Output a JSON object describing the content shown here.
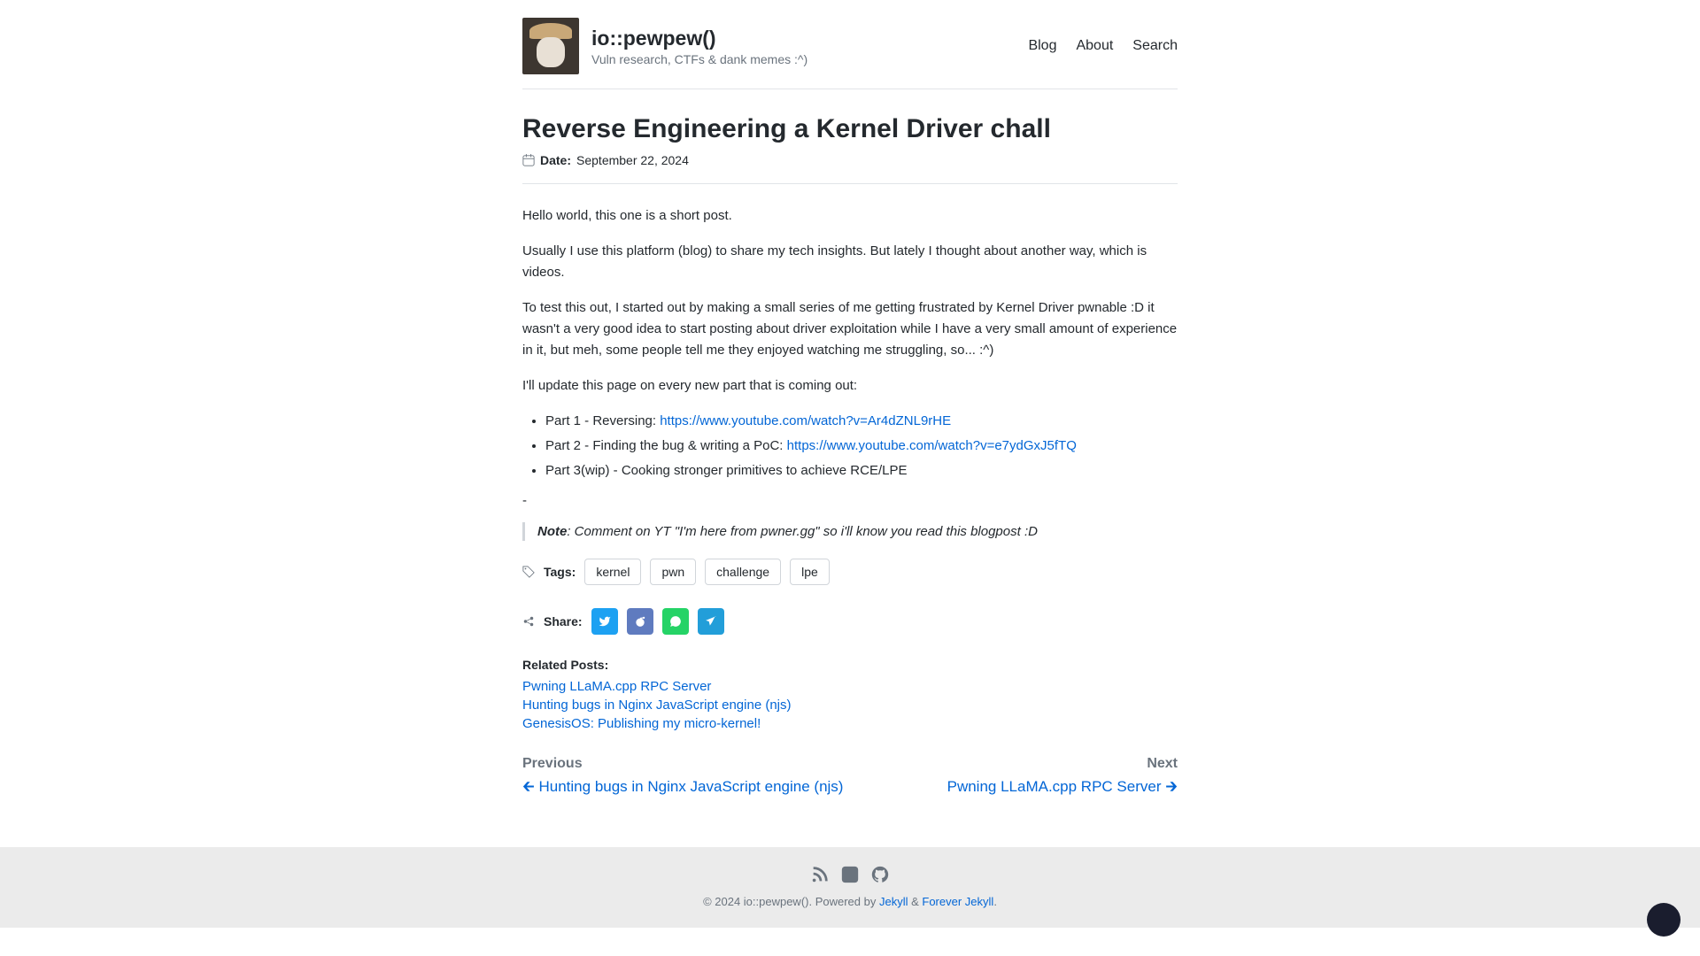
{
  "brand": {
    "title": "io::pewpew()",
    "tagline": "Vuln research, CTFs & dank memes :^)"
  },
  "nav": {
    "blog": "Blog",
    "about": "About",
    "search": "Search"
  },
  "post": {
    "title": "Reverse Engineering a Kernel Driver chall",
    "date_label": "Date:",
    "date": "September 22, 2024",
    "p1": "Hello world, this one is a short post.",
    "p2": "Usually I use this platform (blog) to share my tech insights. But lately I thought about another way, which is videos.",
    "p3": "To test this out, I started out by making a small series of me getting frustrated by Kernel Driver pwnable :D it wasn't a very good idea to start posting about driver exploitation while I have a very small amount of experience in it, but meh, some people tell me they enjoyed watching me struggling, so... :^)",
    "p4": "I'll update this page on every new part that is coming out:",
    "li1_prefix": "Part 1 - Reversing: ",
    "li1_link": "https://www.youtube.com/watch?v=Ar4dZNL9rHE",
    "li2_prefix": "Part 2 - Finding the bug & writing a PoC: ",
    "li2_link": "https://www.youtube.com/watch?v=e7ydGxJ5fTQ",
    "li3": "Part 3(wip) - Cooking stronger primitives to achieve RCE/LPE",
    "dash": "-",
    "note_strong": "Note",
    "note_rest": ": Comment on YT \"I'm here from pwner.gg\" so i'll know you read this blogpost :D"
  },
  "tags": {
    "label": "Tags:",
    "items": [
      "kernel",
      "pwn",
      "challenge",
      "lpe"
    ]
  },
  "share": {
    "label": "Share:"
  },
  "related": {
    "heading": "Related Posts:",
    "items": [
      "Pwning LLaMA.cpp RPC Server",
      "Hunting bugs in Nginx JavaScript engine (njs)",
      "GenesisOS: Publishing my micro-kernel!"
    ]
  },
  "pager": {
    "prev_label": "Previous",
    "prev_title": "Hunting bugs in Nginx JavaScript engine (njs)",
    "next_label": "Next",
    "next_title": "Pwning LLaMA.cpp RPC Server"
  },
  "footer": {
    "copy_prefix": "© 2024 io::pewpew(). Powered by ",
    "jekyll": "Jekyll",
    "amp": " & ",
    "forever": "Forever Jekyll",
    "dot": "."
  }
}
